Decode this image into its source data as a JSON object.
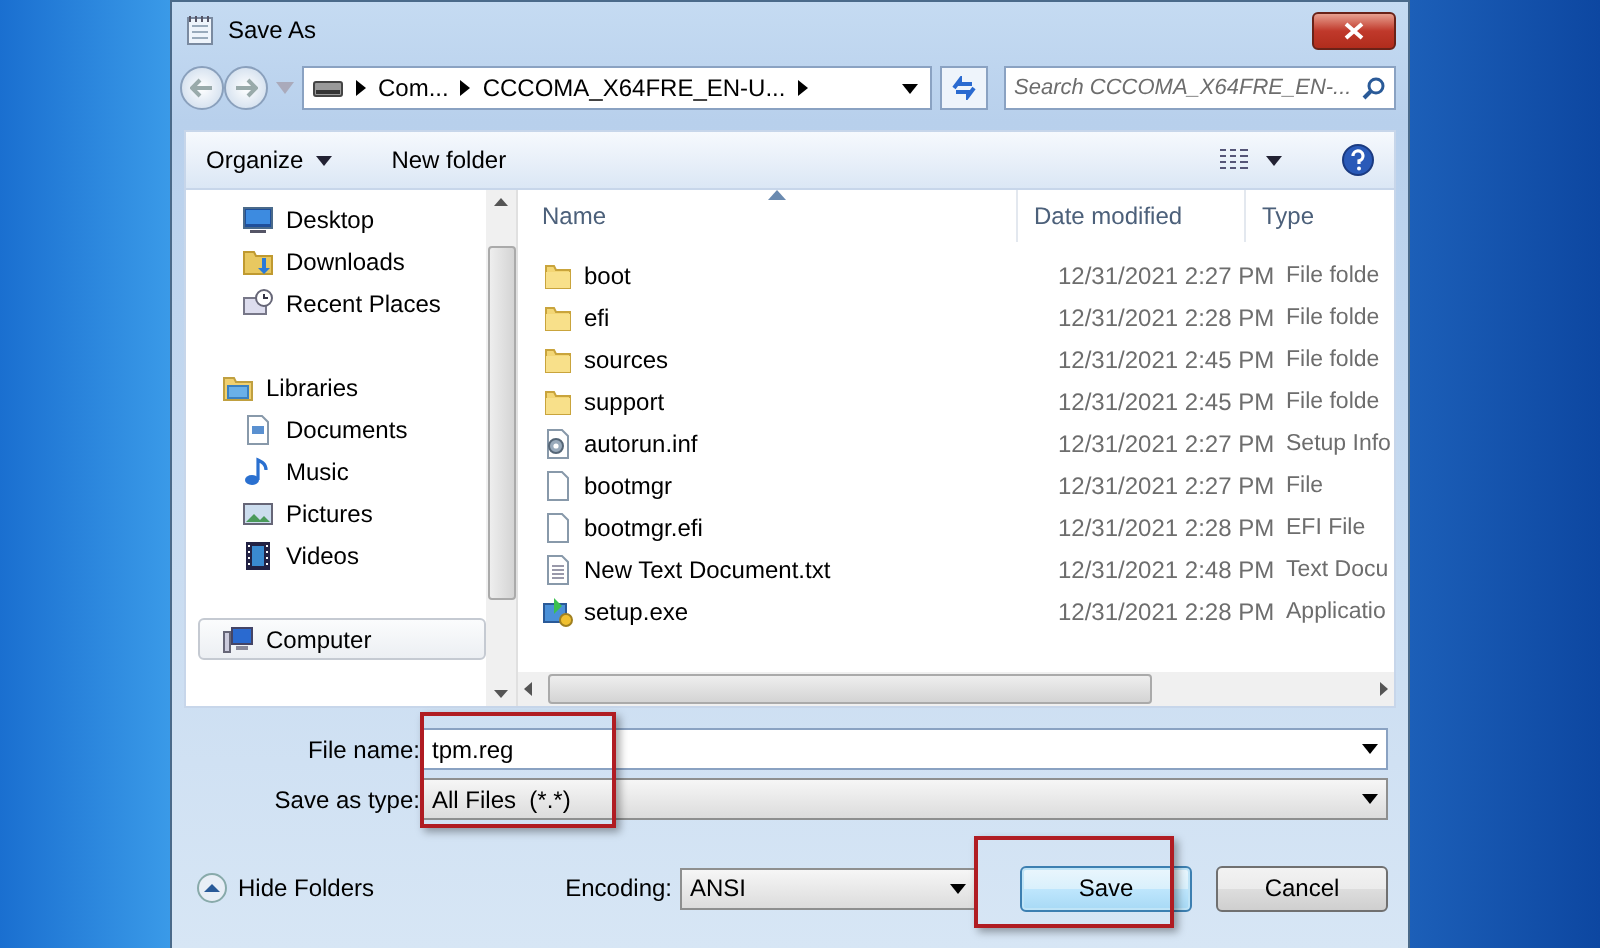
{
  "window": {
    "title": "Save As"
  },
  "address": {
    "crumbs": [
      "Com...",
      "CCCOMA_X64FRE_EN-U..."
    ]
  },
  "search": {
    "placeholder": "Search CCCOMA_X64FRE_EN-..."
  },
  "toolbar": {
    "organize": "Organize",
    "new_folder": "New folder"
  },
  "nav": [
    {
      "label": "Desktop",
      "kind": "desktop",
      "selected": false
    },
    {
      "label": "Downloads",
      "kind": "downloads",
      "selected": false
    },
    {
      "label": "Recent Places",
      "kind": "recent",
      "selected": false
    },
    {
      "label": "Libraries",
      "kind": "library",
      "selected": false,
      "children": [
        {
          "label": "Documents",
          "kind": "documents",
          "selected": false
        },
        {
          "label": "Music",
          "kind": "music",
          "selected": false
        },
        {
          "label": "Pictures",
          "kind": "pictures",
          "selected": false
        },
        {
          "label": "Videos",
          "kind": "videos",
          "selected": false
        }
      ]
    },
    {
      "label": "Computer",
      "kind": "computer",
      "selected": true
    }
  ],
  "table": {
    "columns": [
      {
        "label": "Name",
        "sorted": true
      },
      {
        "label": "Date modified",
        "sorted": false
      },
      {
        "label": "Type",
        "sorted": false
      }
    ],
    "rows": [
      {
        "kind": "folder",
        "name": "boot",
        "date": "12/31/2021 2:27 PM",
        "type": "File folde"
      },
      {
        "kind": "folder",
        "name": "efi",
        "date": "12/31/2021 2:28 PM",
        "type": "File folde"
      },
      {
        "kind": "folder",
        "name": "sources",
        "date": "12/31/2021 2:45 PM",
        "type": "File folde"
      },
      {
        "kind": "folder",
        "name": "support",
        "date": "12/31/2021 2:45 PM",
        "type": "File folde"
      },
      {
        "kind": "settings",
        "name": "autorun.inf",
        "date": "12/31/2021 2:27 PM",
        "type": "Setup Info"
      },
      {
        "kind": "file",
        "name": "bootmgr",
        "date": "12/31/2021 2:27 PM",
        "type": "File"
      },
      {
        "kind": "file",
        "name": "bootmgr.efi",
        "date": "12/31/2021 2:28 PM",
        "type": "EFI File"
      },
      {
        "kind": "text",
        "name": "New Text Document.txt",
        "date": "12/31/2021 2:48 PM",
        "type": "Text Docu"
      },
      {
        "kind": "app",
        "name": "setup.exe",
        "date": "12/31/2021 2:28 PM",
        "type": "Applicatio"
      }
    ]
  },
  "footer": {
    "file_name": {
      "label": "File name:",
      "value": "tpm.reg"
    },
    "save_type": {
      "label": "Save as type:",
      "value": "All Files  (*.*)"
    },
    "fields_highlighted": true,
    "hide_folders": "Hide Folders",
    "encoding": {
      "label": "Encoding:",
      "value": "ANSI"
    },
    "buttons": [
      {
        "label": "Save",
        "default": true,
        "highlighted": true
      },
      {
        "label": "Cancel",
        "default": false,
        "highlighted": false
      }
    ]
  }
}
